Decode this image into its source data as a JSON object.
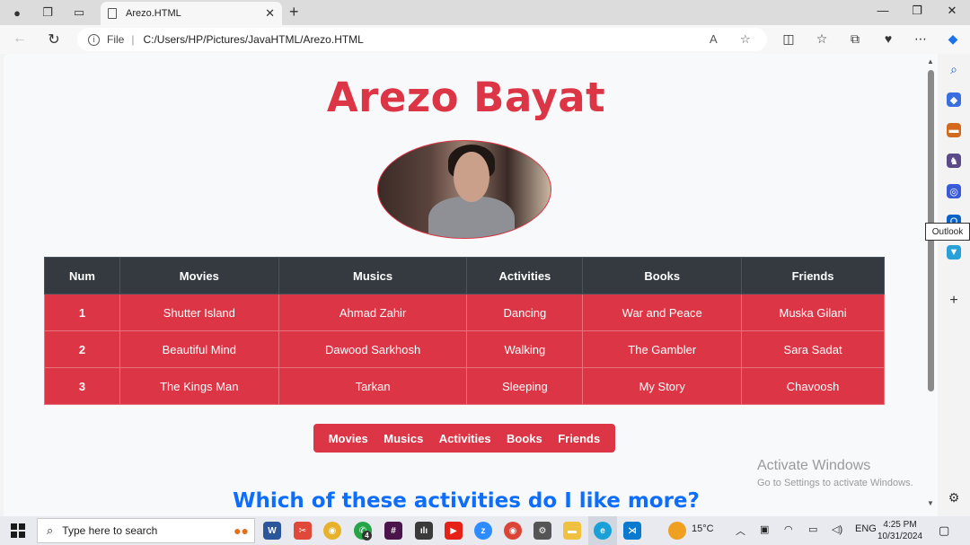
{
  "browser": {
    "tab_title": "Arezo.HTML",
    "address_scheme": "File",
    "address_url": "C:/Users/HP/Pictures/JavaHTML/Arezo.HTML",
    "sidebar_tooltip": "Outlook"
  },
  "page": {
    "title": "Arezo Bayat",
    "table": {
      "headers": [
        "Num",
        "Movies",
        "Musics",
        "Activities",
        "Books",
        "Friends"
      ],
      "rows": [
        [
          "1",
          "Shutter Island",
          "Ahmad Zahir",
          "Dancing",
          "War and Peace",
          "Muska Gilani"
        ],
        [
          "2",
          "Beautiful Mind",
          "Dawood Sarkhosh",
          "Walking",
          "The Gambler",
          "Sara Sadat"
        ],
        [
          "3",
          "The Kings Man",
          "Tarkan",
          "Sleeping",
          "My Story",
          "Chavoosh"
        ]
      ]
    },
    "nav": [
      "Movies",
      "Musics",
      "Activities",
      "Books",
      "Friends"
    ],
    "question": "Which of these activities do I like more?"
  },
  "watermark": {
    "line1": "Activate Windows",
    "line2": "Go to Settings to activate Windows."
  },
  "taskbar": {
    "search_placeholder": "Type here to search",
    "temperature": "15°C",
    "language": "ENG",
    "time": "4:25 PM",
    "date": "10/31/2024",
    "whatsapp_badge": "4"
  },
  "colors": {
    "accent_red": "#dc3545",
    "table_header": "#343a40",
    "question_blue": "#0d6efd"
  }
}
